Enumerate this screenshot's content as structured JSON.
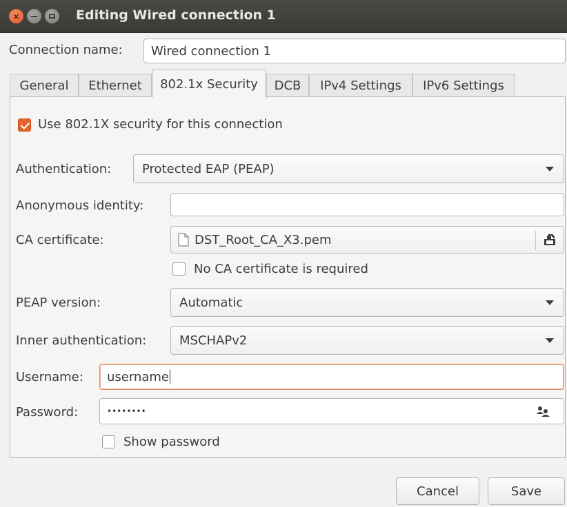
{
  "window": {
    "title": "Editing Wired connection 1",
    "close_glyph": "×"
  },
  "connection": {
    "label": "Connection name:",
    "value": "Wired connection 1"
  },
  "tabs": [
    {
      "label": "General"
    },
    {
      "label": "Ethernet"
    },
    {
      "label": "802.1x Security",
      "active": true
    },
    {
      "label": "DCB"
    },
    {
      "label": "IPv4 Settings"
    },
    {
      "label": "IPv6 Settings"
    }
  ],
  "security": {
    "use_8021x_label": "Use 802.1X security for this connection",
    "use_8021x_checked": true,
    "authentication_label": "Authentication:",
    "authentication_value": "Protected EAP (PEAP)",
    "anonymous_identity_label": "Anonymous identity:",
    "anonymous_identity_value": "",
    "ca_certificate_label": "CA certificate:",
    "ca_certificate_value": "DST_Root_CA_X3.pem",
    "no_ca_label": "No CA certificate is required",
    "no_ca_checked": false,
    "peap_version_label": "PEAP version:",
    "peap_version_value": "Automatic",
    "inner_auth_label": "Inner authentication:",
    "inner_auth_value": "MSCHAPv2",
    "username_label": "Username:",
    "username_value": "username",
    "password_label": "Password:",
    "password_value": "••••••••",
    "show_password_label": "Show password",
    "show_password_checked": false
  },
  "buttons": {
    "cancel": "Cancel",
    "save": "Save"
  },
  "colors": {
    "accent": "#e5642d",
    "focus_border": "#e58a5f",
    "titlebar": "#3b3a36"
  },
  "icons": {
    "close": "close-icon",
    "minimize": "minimize-icon",
    "maximize": "maximize-icon",
    "file": "file-icon",
    "file_chooser": "file-chooser-icon",
    "password_store": "users-icon"
  }
}
